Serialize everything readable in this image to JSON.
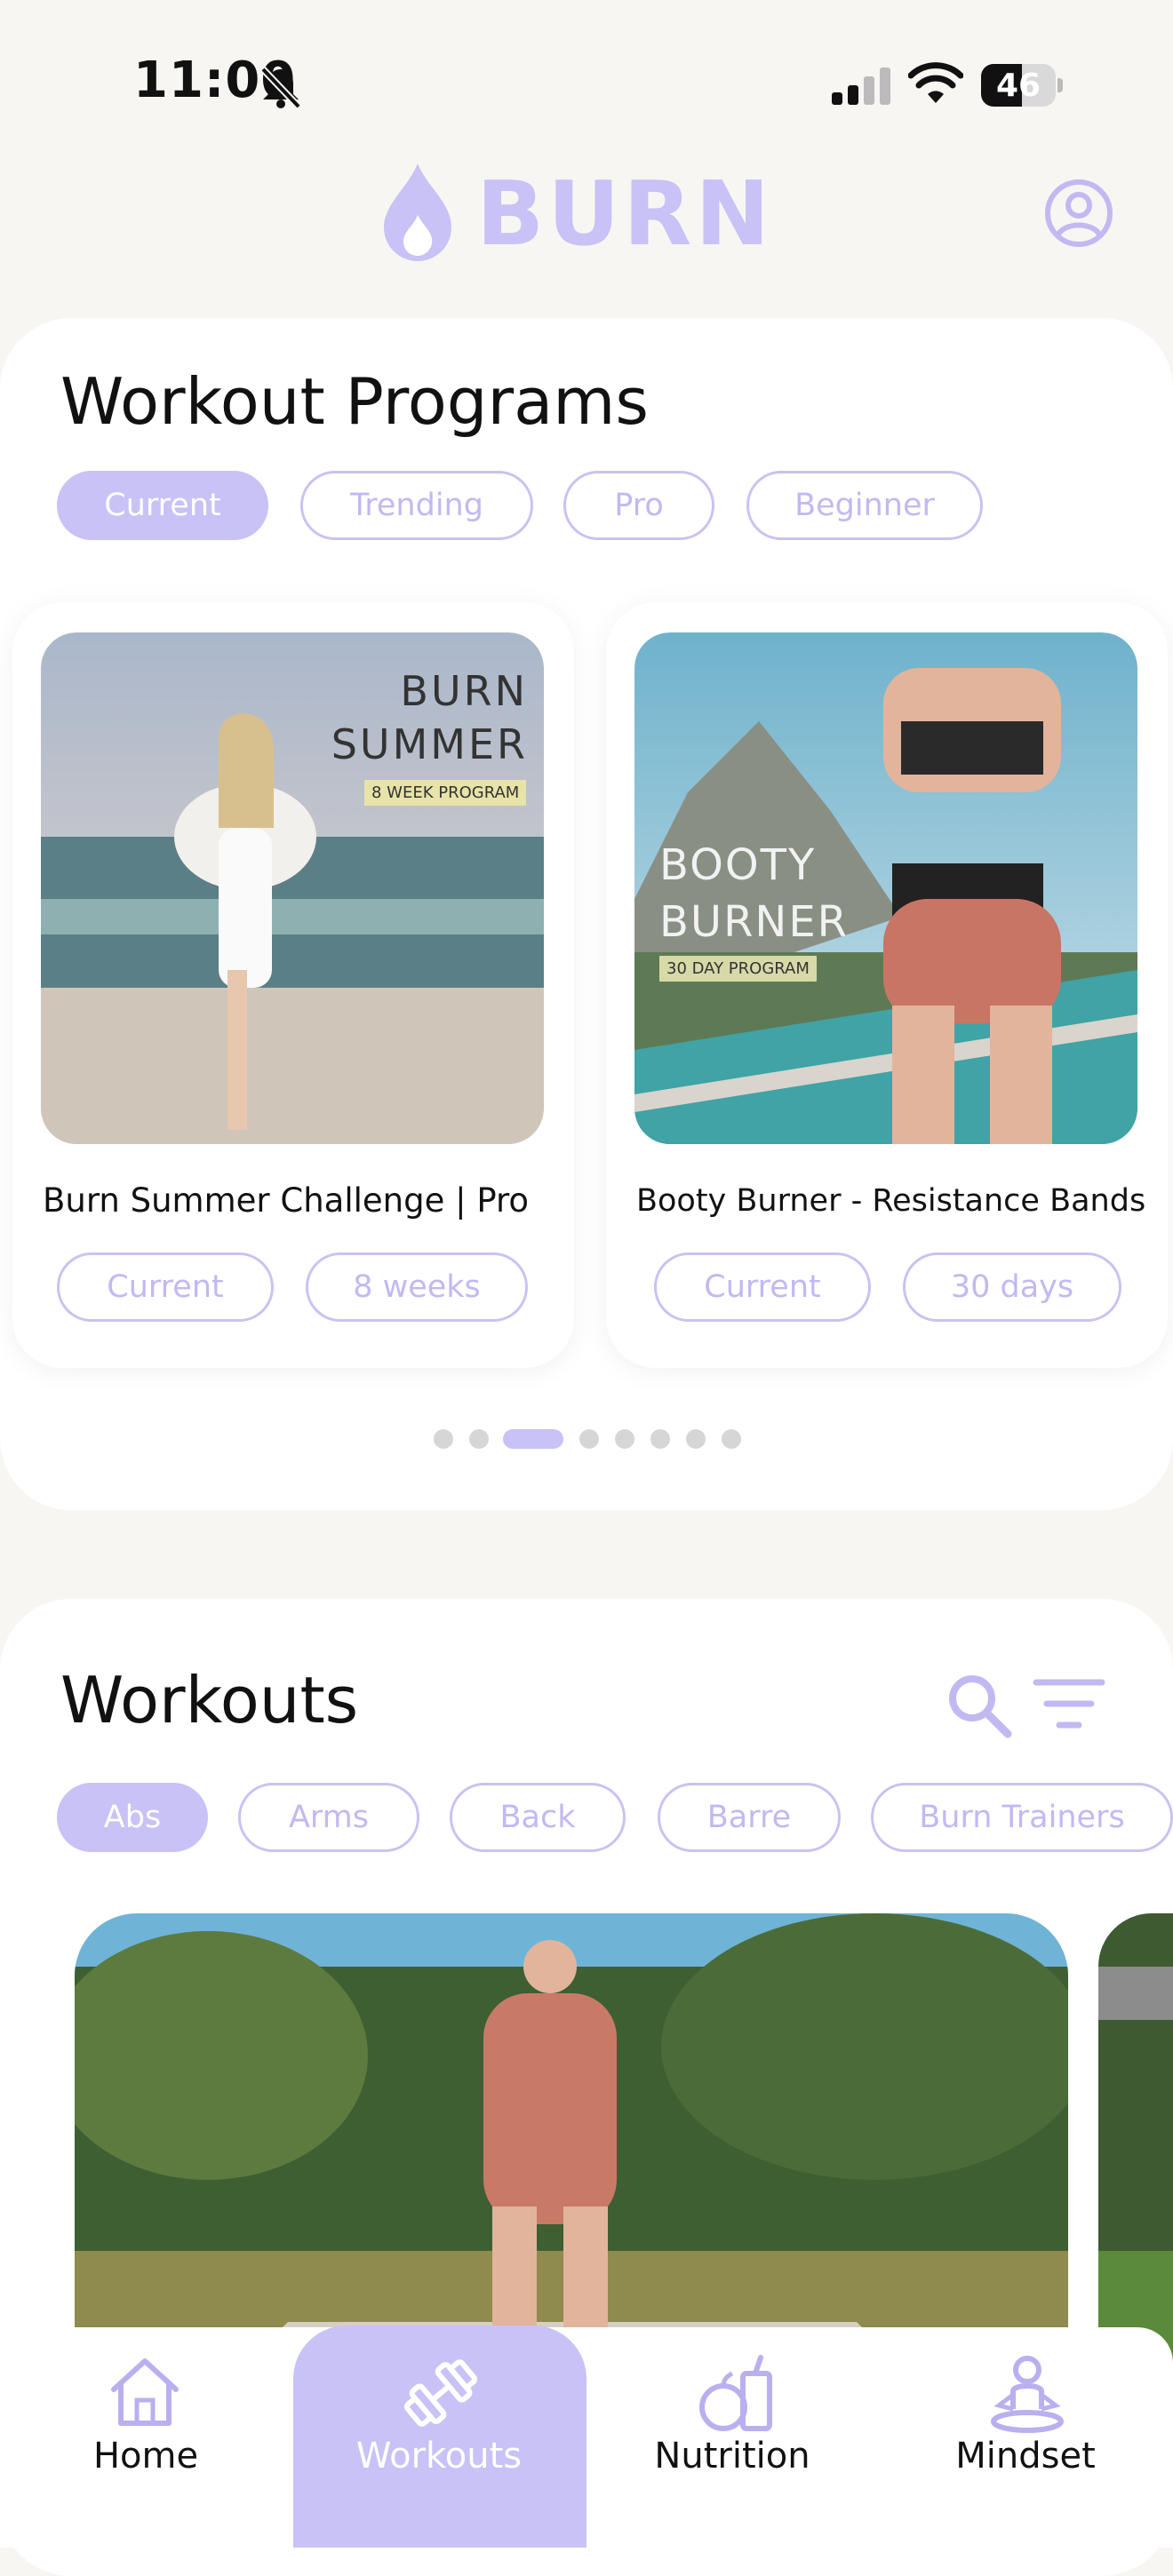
{
  "status_bar": {
    "time": "11:00",
    "battery": "46"
  },
  "header": {
    "logo_text": "BURN"
  },
  "programs": {
    "title": "Workout Programs",
    "filters": [
      "Current",
      "Trending",
      "Pro",
      "Beginner"
    ],
    "cards": [
      {
        "image_title_line1": "BURN",
        "image_title_line2": "SUMMER",
        "image_badge": "8 WEEK PROGRAM",
        "title": "Burn Summer Challenge | Pro",
        "tags": [
          "Current",
          "8 weeks"
        ]
      },
      {
        "image_title_line1": "BOOTY",
        "image_title_line2": "BURNER",
        "image_badge": "30 DAY PROGRAM",
        "title": "Booty Burner - Resistance Bands",
        "tags": [
          "Current",
          "30 days"
        ]
      }
    ],
    "page_count": 8,
    "active_page": 3
  },
  "workouts": {
    "title": "Workouts",
    "filters": [
      "Abs",
      "Arms",
      "Back",
      "Barre",
      "Burn Trainers"
    ]
  },
  "tab_bar": {
    "items": [
      "Home",
      "Workouts",
      "Nutrition",
      "Mindset"
    ],
    "active": "Workouts"
  },
  "colors": {
    "accent": "#c8c2f6",
    "accent_text": "#c2b9f2"
  }
}
